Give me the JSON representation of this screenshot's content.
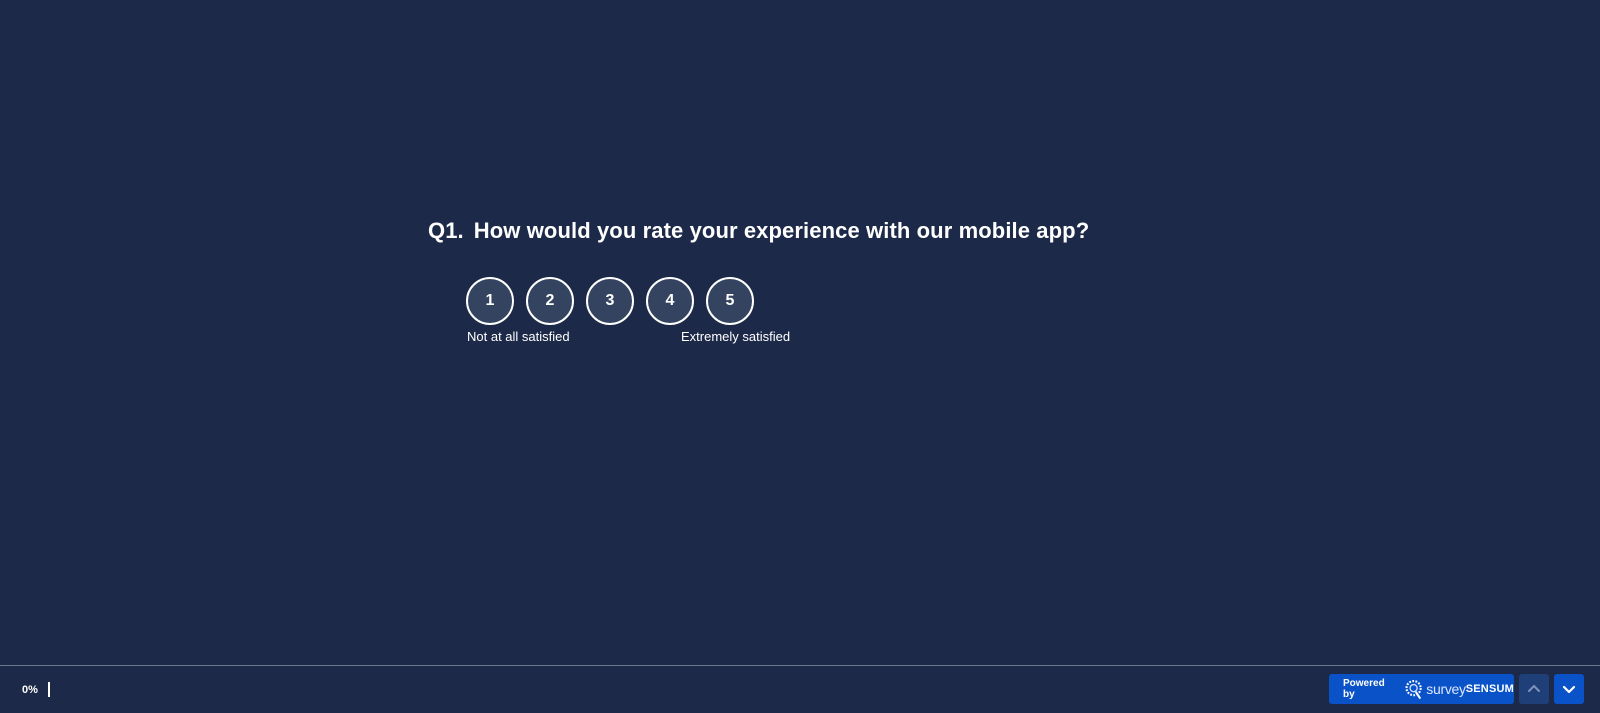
{
  "question": {
    "number": "Q1.",
    "text": "How would you rate your experience with our mobile app?"
  },
  "rating": {
    "options": [
      "1",
      "2",
      "3",
      "4",
      "5"
    ],
    "low_label": "Not at all satisfied",
    "high_label": "Extremely satisfied"
  },
  "footer": {
    "progress_text": "0%",
    "progress_value": 0,
    "powered_by": "Powered by",
    "brand_light": "survey",
    "brand_bold": "SENSUM",
    "up_icon": "chevron-up-icon",
    "down_icon": "chevron-down-icon"
  },
  "colors": {
    "background": "#1c2948",
    "button_fill": "#34435f",
    "accent": "#0a52c8",
    "nav_up": "#1f3f78"
  }
}
